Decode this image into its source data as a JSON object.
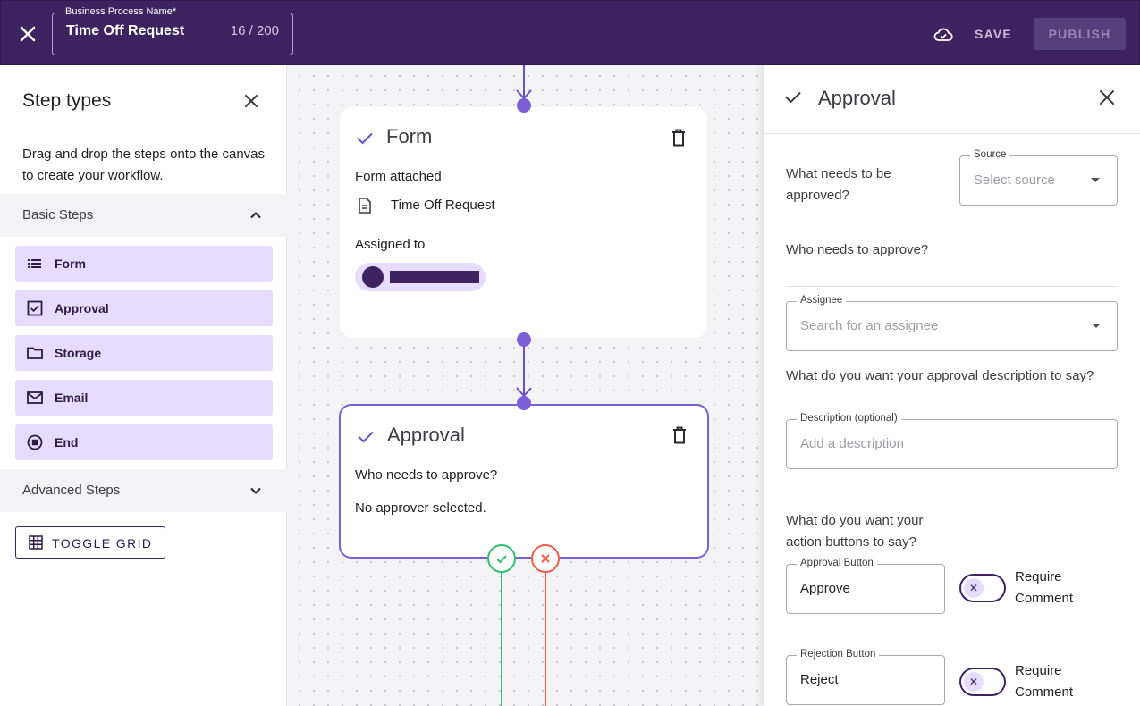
{
  "topbar": {
    "name_label": "Business Process Name*",
    "name_value": "Time Off Request",
    "name_count": "16 / 200",
    "save_label": "SAVE",
    "publish_label": "PUBLISH"
  },
  "left_panel": {
    "title": "Step types",
    "description": "Drag and drop the steps onto the canvas to create your workflow.",
    "basic_section": "Basic Steps",
    "steps": [
      {
        "label": "Form",
        "icon": "list-icon"
      },
      {
        "label": "Approval",
        "icon": "checkbox-icon"
      },
      {
        "label": "Storage",
        "icon": "folder-icon"
      },
      {
        "label": "Email",
        "icon": "mail-icon"
      },
      {
        "label": "End",
        "icon": "stop-circle-icon"
      }
    ],
    "advanced_section": "Advanced Steps",
    "toggle_grid_label": "TOGGLE GRID"
  },
  "canvas": {
    "form_node": {
      "title": "Form",
      "form_attached_label": "Form attached",
      "form_name": "Time Off Request",
      "assigned_to_label": "Assigned to"
    },
    "approval_node": {
      "title": "Approval",
      "question": "Who needs to approve?",
      "no_approver": "No approver selected."
    }
  },
  "right_panel": {
    "title": "Approval",
    "what_question": "What needs to be approved?",
    "source": {
      "label": "Source",
      "placeholder": "Select source"
    },
    "who_question": "Who needs to approve?",
    "assignee": {
      "label": "Assignee",
      "placeholder": "Search for an assignee"
    },
    "description_question": "What do you want your approval description to say?",
    "description": {
      "label": "Description (optional)",
      "placeholder": "Add a description"
    },
    "buttons_question": "What do you want your action buttons to say?",
    "approval_button": {
      "label": "Approval Button",
      "value": "Approve"
    },
    "rejection_button": {
      "label": "Rejection Button",
      "value": "Reject"
    },
    "require_comment_label": "Require Comment"
  },
  "colors": {
    "brand": "#3d2461",
    "accent": "#6b4fc9",
    "step_bg": "#e6dcfd",
    "approve": "#2fbf71",
    "reject": "#ef5b4c"
  }
}
